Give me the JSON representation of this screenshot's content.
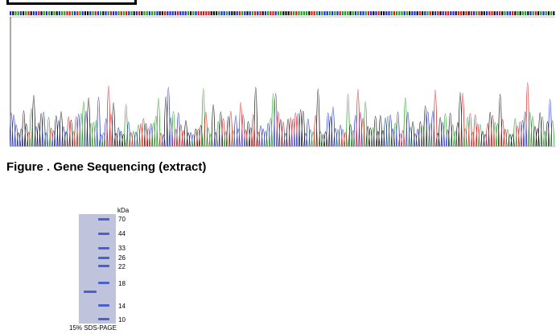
{
  "figure": {
    "caption": "Figure . Gene Sequencing (extract)"
  },
  "chromatogram": {
    "colors": {
      "A": "#2b9b2b",
      "C": "#2030c8",
      "G": "#111111",
      "T": "#d02020"
    },
    "icon": "dna-chromatogram"
  },
  "gel": {
    "unit": "kDa",
    "markers": [
      "70",
      "44",
      "33",
      "26",
      "22",
      "18",
      "14",
      "10"
    ],
    "label": "15% SDS-PAGE",
    "band_color": "#4a5fd0",
    "gel_color": "#bfc4dc"
  }
}
